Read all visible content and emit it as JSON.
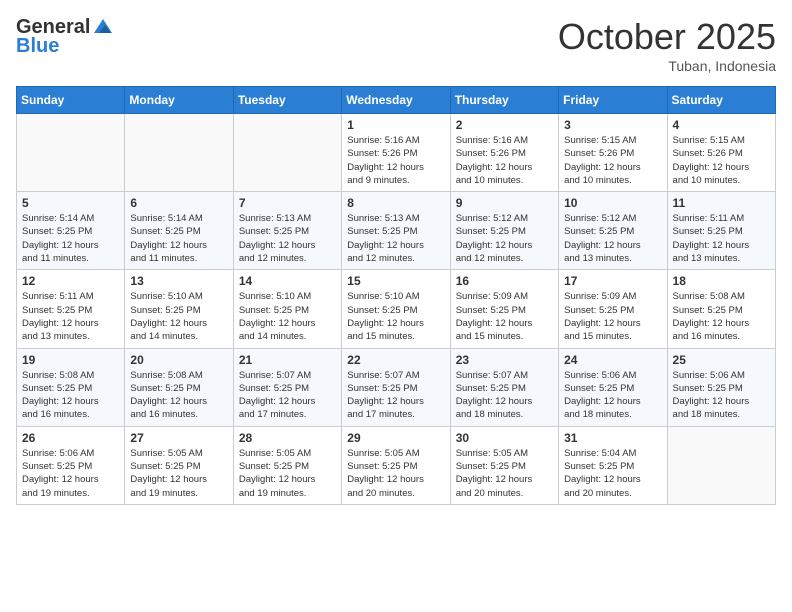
{
  "header": {
    "logo_line1": "General",
    "logo_line2": "Blue",
    "month": "October 2025",
    "location": "Tuban, Indonesia"
  },
  "weekdays": [
    "Sunday",
    "Monday",
    "Tuesday",
    "Wednesday",
    "Thursday",
    "Friday",
    "Saturday"
  ],
  "rows": [
    [
      {
        "day": "",
        "info": ""
      },
      {
        "day": "",
        "info": ""
      },
      {
        "day": "",
        "info": ""
      },
      {
        "day": "1",
        "info": "Sunrise: 5:16 AM\nSunset: 5:26 PM\nDaylight: 12 hours\nand 9 minutes."
      },
      {
        "day": "2",
        "info": "Sunrise: 5:16 AM\nSunset: 5:26 PM\nDaylight: 12 hours\nand 10 minutes."
      },
      {
        "day": "3",
        "info": "Sunrise: 5:15 AM\nSunset: 5:26 PM\nDaylight: 12 hours\nand 10 minutes."
      },
      {
        "day": "4",
        "info": "Sunrise: 5:15 AM\nSunset: 5:26 PM\nDaylight: 12 hours\nand 10 minutes."
      }
    ],
    [
      {
        "day": "5",
        "info": "Sunrise: 5:14 AM\nSunset: 5:25 PM\nDaylight: 12 hours\nand 11 minutes."
      },
      {
        "day": "6",
        "info": "Sunrise: 5:14 AM\nSunset: 5:25 PM\nDaylight: 12 hours\nand 11 minutes."
      },
      {
        "day": "7",
        "info": "Sunrise: 5:13 AM\nSunset: 5:25 PM\nDaylight: 12 hours\nand 12 minutes."
      },
      {
        "day": "8",
        "info": "Sunrise: 5:13 AM\nSunset: 5:25 PM\nDaylight: 12 hours\nand 12 minutes."
      },
      {
        "day": "9",
        "info": "Sunrise: 5:12 AM\nSunset: 5:25 PM\nDaylight: 12 hours\nand 12 minutes."
      },
      {
        "day": "10",
        "info": "Sunrise: 5:12 AM\nSunset: 5:25 PM\nDaylight: 12 hours\nand 13 minutes."
      },
      {
        "day": "11",
        "info": "Sunrise: 5:11 AM\nSunset: 5:25 PM\nDaylight: 12 hours\nand 13 minutes."
      }
    ],
    [
      {
        "day": "12",
        "info": "Sunrise: 5:11 AM\nSunset: 5:25 PM\nDaylight: 12 hours\nand 13 minutes."
      },
      {
        "day": "13",
        "info": "Sunrise: 5:10 AM\nSunset: 5:25 PM\nDaylight: 12 hours\nand 14 minutes."
      },
      {
        "day": "14",
        "info": "Sunrise: 5:10 AM\nSunset: 5:25 PM\nDaylight: 12 hours\nand 14 minutes."
      },
      {
        "day": "15",
        "info": "Sunrise: 5:10 AM\nSunset: 5:25 PM\nDaylight: 12 hours\nand 15 minutes."
      },
      {
        "day": "16",
        "info": "Sunrise: 5:09 AM\nSunset: 5:25 PM\nDaylight: 12 hours\nand 15 minutes."
      },
      {
        "day": "17",
        "info": "Sunrise: 5:09 AM\nSunset: 5:25 PM\nDaylight: 12 hours\nand 15 minutes."
      },
      {
        "day": "18",
        "info": "Sunrise: 5:08 AM\nSunset: 5:25 PM\nDaylight: 12 hours\nand 16 minutes."
      }
    ],
    [
      {
        "day": "19",
        "info": "Sunrise: 5:08 AM\nSunset: 5:25 PM\nDaylight: 12 hours\nand 16 minutes."
      },
      {
        "day": "20",
        "info": "Sunrise: 5:08 AM\nSunset: 5:25 PM\nDaylight: 12 hours\nand 16 minutes."
      },
      {
        "day": "21",
        "info": "Sunrise: 5:07 AM\nSunset: 5:25 PM\nDaylight: 12 hours\nand 17 minutes."
      },
      {
        "day": "22",
        "info": "Sunrise: 5:07 AM\nSunset: 5:25 PM\nDaylight: 12 hours\nand 17 minutes."
      },
      {
        "day": "23",
        "info": "Sunrise: 5:07 AM\nSunset: 5:25 PM\nDaylight: 12 hours\nand 18 minutes."
      },
      {
        "day": "24",
        "info": "Sunrise: 5:06 AM\nSunset: 5:25 PM\nDaylight: 12 hours\nand 18 minutes."
      },
      {
        "day": "25",
        "info": "Sunrise: 5:06 AM\nSunset: 5:25 PM\nDaylight: 12 hours\nand 18 minutes."
      }
    ],
    [
      {
        "day": "26",
        "info": "Sunrise: 5:06 AM\nSunset: 5:25 PM\nDaylight: 12 hours\nand 19 minutes."
      },
      {
        "day": "27",
        "info": "Sunrise: 5:05 AM\nSunset: 5:25 PM\nDaylight: 12 hours\nand 19 minutes."
      },
      {
        "day": "28",
        "info": "Sunrise: 5:05 AM\nSunset: 5:25 PM\nDaylight: 12 hours\nand 19 minutes."
      },
      {
        "day": "29",
        "info": "Sunrise: 5:05 AM\nSunset: 5:25 PM\nDaylight: 12 hours\nand 20 minutes."
      },
      {
        "day": "30",
        "info": "Sunrise: 5:05 AM\nSunset: 5:25 PM\nDaylight: 12 hours\nand 20 minutes."
      },
      {
        "day": "31",
        "info": "Sunrise: 5:04 AM\nSunset: 5:25 PM\nDaylight: 12 hours\nand 20 minutes."
      },
      {
        "day": "",
        "info": ""
      }
    ]
  ]
}
